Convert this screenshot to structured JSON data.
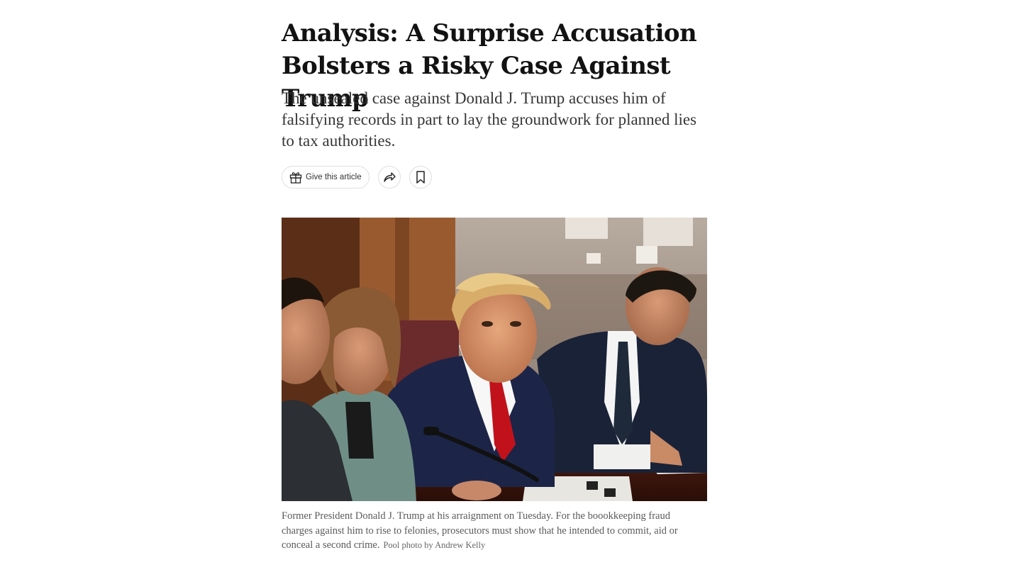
{
  "article": {
    "headline": "Analysis: A Surprise Accusation Bolsters a Risky Case Against Trump",
    "summary": "The unsealed case against Donald J. Trump accuses him of falsifying records in part to lay the groundwork for planned lies to tax authorities.",
    "actions": {
      "gift_label": "Give this article",
      "gift_icon": "gift-icon",
      "share_icon": "share-arrow-icon",
      "save_icon": "bookmark-icon"
    },
    "image": {
      "caption": "Former President Donald J. Trump at his arraignment on Tuesday. For the boookkeeping fraud charges against him to rise to felonies, prosecutors must show that he intended to commit, aid or conceal a second crime.",
      "credit": "Pool photo by Andrew Kelly"
    }
  },
  "colors": {
    "text": "#121212",
    "summary": "#363636",
    "caption": "#5a5a5a",
    "border": "#dfdfdf"
  }
}
